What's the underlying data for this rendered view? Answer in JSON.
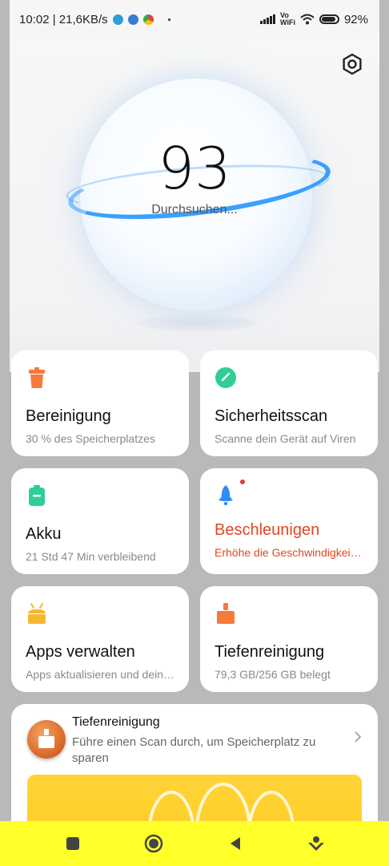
{
  "status": {
    "time_speed": "10:02 | 21,6KB/s",
    "network": "Vo WiFi",
    "network_top": "Vo",
    "network_bottom": "WiFi",
    "battery": "92%"
  },
  "hero": {
    "score": "93",
    "scan_text": "Durchsuchen..."
  },
  "cards": [
    {
      "title": "Bereinigung",
      "subtitle": "30 % des Speicherplatzes",
      "icon": "trash-icon",
      "color": "#f57a3b"
    },
    {
      "title": "Sicherheitsscan",
      "subtitle": "Scanne dein Gerät auf Viren",
      "icon": "shield-check-icon",
      "color": "#2ecf95"
    },
    {
      "title": "Akku",
      "subtitle": "21 Std 47 Min  verbleibend",
      "icon": "battery-icon",
      "color": "#2ecf95"
    },
    {
      "title": "Beschleunigen",
      "subtitle": "Erhöhe die Geschwindigkeit…",
      "icon": "rocket-icon",
      "color": "#2d8cf5"
    },
    {
      "title": "Apps verwalten",
      "subtitle": "Apps aktualisieren und dein…",
      "icon": "android-icon",
      "color": "#f7b731"
    },
    {
      "title": "Tiefenreinigung",
      "subtitle": "79,3 GB/256 GB belegt",
      "icon": "broom-icon",
      "color": "#f57a3b"
    }
  ],
  "deep_clean": {
    "title": "Tiefenreinigung",
    "subtitle": "Führe einen Scan durch, um Speicherplatz zu sparen"
  },
  "accent_color": "#e0481f"
}
